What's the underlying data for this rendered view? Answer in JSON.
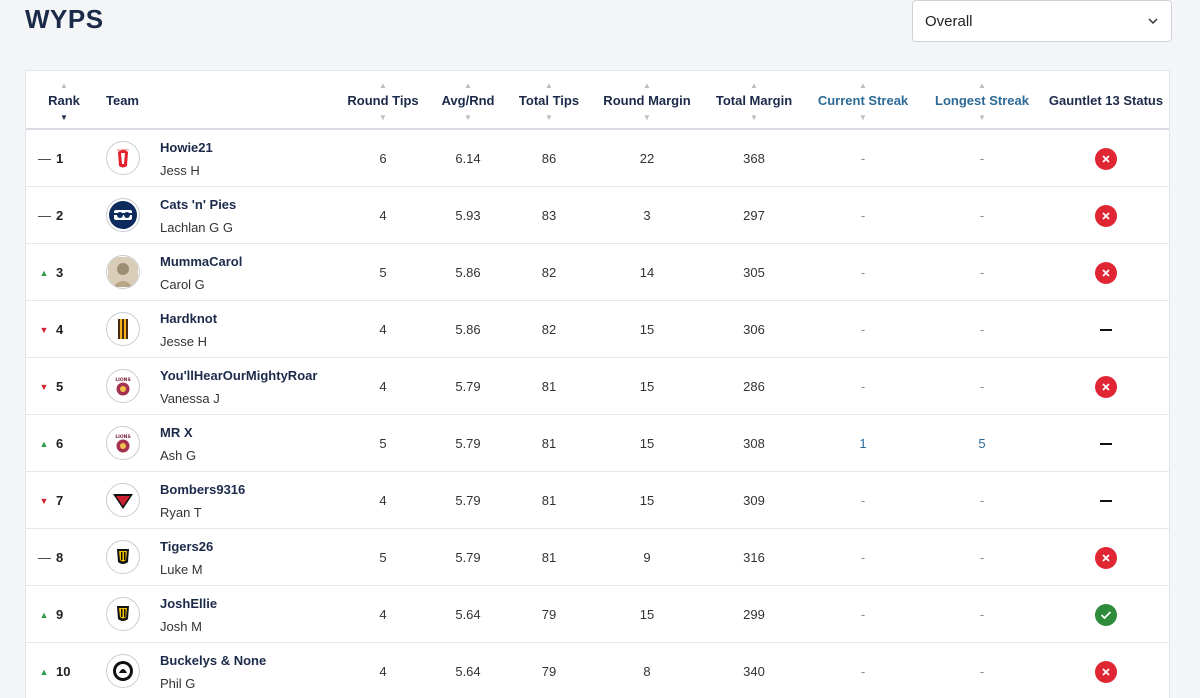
{
  "header": {
    "title": "WYPS",
    "select_value": "Overall"
  },
  "columns": {
    "rank": "Rank",
    "team": "Team",
    "round_tips": "Round Tips",
    "avg_rnd": "Avg/Rnd",
    "total_tips": "Total Tips",
    "round_margin": "Round Margin",
    "total_margin": "Total Margin",
    "current_streak": "Current Streak",
    "longest_streak": "Longest Streak",
    "gauntlet": "Gauntlet 13 Status"
  },
  "rows": [
    {
      "rank_change": "same",
      "rank_indicator": "—",
      "rank": "1",
      "logo": "swans-logo-icon",
      "team": "Howie21",
      "user": "Jess H",
      "round_tips": "6",
      "avg_rnd": "6.14",
      "total_tips": "86",
      "round_margin": "22",
      "total_margin": "368",
      "current_streak": "-",
      "longest_streak": "-",
      "gauntlet": "eliminated"
    },
    {
      "rank_change": "same",
      "rank_indicator": "—",
      "rank": "2",
      "logo": "cats-logo-icon",
      "team": "Cats 'n' Pies",
      "user": "Lachlan G G",
      "round_tips": "4",
      "avg_rnd": "5.93",
      "total_tips": "83",
      "round_margin": "3",
      "total_margin": "297",
      "current_streak": "-",
      "longest_streak": "-",
      "gauntlet": "eliminated"
    },
    {
      "rank_change": "up",
      "rank_indicator": "▲",
      "rank": "3",
      "logo": "photo-avatar-icon",
      "team": "MummaCarol",
      "user": "Carol G",
      "round_tips": "5",
      "avg_rnd": "5.86",
      "total_tips": "82",
      "round_margin": "14",
      "total_margin": "305",
      "current_streak": "-",
      "longest_streak": "-",
      "gauntlet": "eliminated"
    },
    {
      "rank_change": "down",
      "rank_indicator": "▼",
      "rank": "4",
      "logo": "hawks-logo-icon",
      "team": "Hardknot",
      "user": "Jesse H",
      "round_tips": "4",
      "avg_rnd": "5.86",
      "total_tips": "82",
      "round_margin": "15",
      "total_margin": "306",
      "current_streak": "-",
      "longest_streak": "-",
      "gauntlet": "none"
    },
    {
      "rank_change": "down",
      "rank_indicator": "▼",
      "rank": "5",
      "logo": "lions-logo-icon",
      "team": "You'llHearOurMightyRoar",
      "user": "Vanessa J",
      "round_tips": "4",
      "avg_rnd": "5.79",
      "total_tips": "81",
      "round_margin": "15",
      "total_margin": "286",
      "current_streak": "-",
      "longest_streak": "-",
      "gauntlet": "eliminated"
    },
    {
      "rank_change": "up",
      "rank_indicator": "▲",
      "rank": "6",
      "logo": "lions-logo-icon",
      "team": "MR X",
      "user": "Ash G",
      "round_tips": "5",
      "avg_rnd": "5.79",
      "total_tips": "81",
      "round_margin": "15",
      "total_margin": "308",
      "current_streak": "1",
      "longest_streak": "5",
      "gauntlet": "none"
    },
    {
      "rank_change": "down",
      "rank_indicator": "▼",
      "rank": "7",
      "logo": "bombers-logo-icon",
      "team": "Bombers9316",
      "user": "Ryan T",
      "round_tips": "4",
      "avg_rnd": "5.79",
      "total_tips": "81",
      "round_margin": "15",
      "total_margin": "309",
      "current_streak": "-",
      "longest_streak": "-",
      "gauntlet": "none"
    },
    {
      "rank_change": "same",
      "rank_indicator": "—",
      "rank": "8",
      "logo": "tigers-logo-icon",
      "team": "Tigers26",
      "user": "Luke M",
      "round_tips": "5",
      "avg_rnd": "5.79",
      "total_tips": "81",
      "round_margin": "9",
      "total_margin": "316",
      "current_streak": "-",
      "longest_streak": "-",
      "gauntlet": "eliminated"
    },
    {
      "rank_change": "up",
      "rank_indicator": "▲",
      "rank": "9",
      "logo": "tigers-logo-icon",
      "team": "JoshEllie",
      "user": "Josh M",
      "round_tips": "4",
      "avg_rnd": "5.64",
      "total_tips": "79",
      "round_margin": "15",
      "total_margin": "299",
      "current_streak": "-",
      "longest_streak": "-",
      "gauntlet": "active"
    },
    {
      "rank_change": "up",
      "rank_indicator": "▲",
      "rank": "10",
      "logo": "magpies-logo-icon",
      "team": "Buckelys & None",
      "user": "Phil G",
      "round_tips": "4",
      "avg_rnd": "5.64",
      "total_tips": "79",
      "round_margin": "8",
      "total_margin": "340",
      "current_streak": "-",
      "longest_streak": "-",
      "gauntlet": "eliminated"
    }
  ]
}
